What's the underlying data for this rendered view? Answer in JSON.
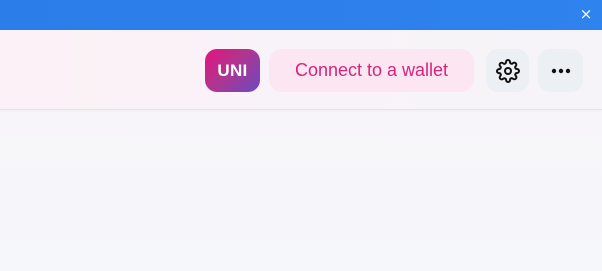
{
  "top_strip": {
    "close_glyph": "×",
    "color": "#2f80ed"
  },
  "header": {
    "token_badge": "UNI",
    "connect_label": "Connect to a wallet",
    "settings_icon": "gear-icon",
    "more_icon": "more-horizontal-icon",
    "accent_color": "#d6247b"
  }
}
